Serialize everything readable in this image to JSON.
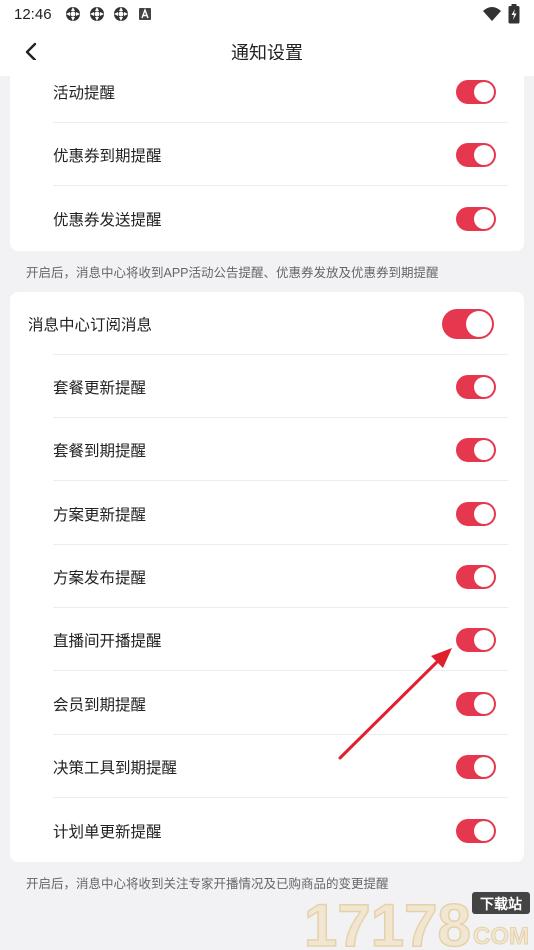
{
  "status_bar": {
    "time": "12:46",
    "icons": [
      "sync-icon",
      "sync-icon",
      "sync-icon",
      "a-badge-icon"
    ],
    "right_icons": [
      "wifi-icon",
      "battery-icon"
    ]
  },
  "header": {
    "title": "通知设置",
    "back_icon": "back-chevron-icon"
  },
  "section1": {
    "items": [
      {
        "label": "活动提醒",
        "enabled": true
      },
      {
        "label": "优惠券到期提醒",
        "enabled": true
      },
      {
        "label": "优惠券发送提醒",
        "enabled": true
      }
    ],
    "hint": "开启后，消息中心将收到APP活动公告提醒、优惠券发放及优惠券到期提醒"
  },
  "section2": {
    "main": {
      "label": "消息中心订阅消息",
      "enabled": true
    },
    "items": [
      {
        "label": "套餐更新提醒",
        "enabled": true
      },
      {
        "label": "套餐到期提醒",
        "enabled": true
      },
      {
        "label": "方案更新提醒",
        "enabled": true
      },
      {
        "label": "方案发布提醒",
        "enabled": true
      },
      {
        "label": "直播间开播提醒",
        "enabled": true
      },
      {
        "label": "会员到期提醒",
        "enabled": true
      },
      {
        "label": "决策工具到期提醒",
        "enabled": true
      },
      {
        "label": "计划单更新提醒",
        "enabled": true
      }
    ],
    "hint": "开启后，消息中心将收到关注专家开播情况及已购商品的变更提醒"
  },
  "colors": {
    "toggle_on": "#e5374e",
    "background": "#f2f2f4",
    "card": "#ffffff",
    "annotation_arrow": "#e0202c"
  },
  "watermark": {
    "number": "17178",
    "tag": "下载站",
    "domain": "COM"
  }
}
